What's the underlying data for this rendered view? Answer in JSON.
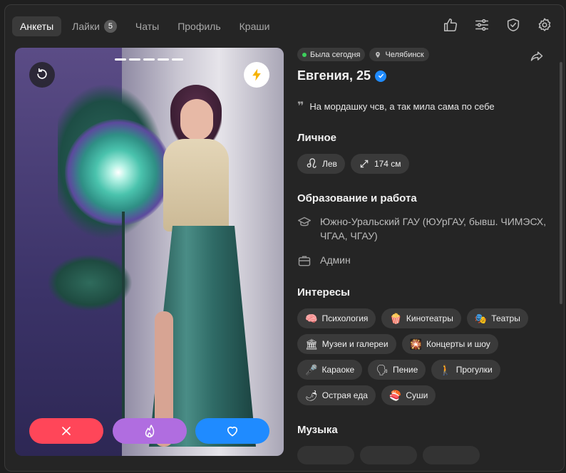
{
  "nav": {
    "tabs": [
      {
        "label": "Анкеты",
        "active": true
      },
      {
        "label": "Лайки",
        "badge": "5"
      },
      {
        "label": "Чаты"
      },
      {
        "label": "Профиль"
      },
      {
        "label": "Краши"
      }
    ],
    "icons": [
      "thumbs-up-icon",
      "filters-icon",
      "shield-check-icon",
      "gear-icon"
    ]
  },
  "card": {
    "photo_count": 5,
    "active_index": 0,
    "buttons": {
      "rewind": "rewind-icon",
      "boost": "lightning-icon",
      "dislike": "close-icon",
      "superlike": "flame-icon",
      "like": "heart-icon"
    }
  },
  "profile": {
    "status": "Была сегодня",
    "city": "Челябинск",
    "name": "Евгения, 25",
    "verified": true,
    "bio": "На мордашку чсв, а так мила сама по себе"
  },
  "personal": {
    "title": "Личное",
    "chips": [
      {
        "icon": "leo-icon",
        "label": "Лев"
      },
      {
        "icon": "height-icon",
        "label": "174 см"
      }
    ]
  },
  "work": {
    "title": "Образование и работа",
    "education": "Южно-Уральский ГАУ (ЮУрГАУ, бывш. ЧИМЭСХ, ЧГАА, ЧГАУ)",
    "job": "Админ"
  },
  "interests": {
    "title": "Интересы",
    "items": [
      {
        "emoji": "🧠",
        "label": "Психология"
      },
      {
        "emoji": "🍿",
        "label": "Кинотеатры"
      },
      {
        "emoji": "🎭",
        "label": "Театры"
      },
      {
        "emoji": "🏛",
        "label": "Музеи и галереи"
      },
      {
        "emoji": "🎇",
        "label": "Концерты и шоу"
      },
      {
        "emoji": "🎤",
        "label": "Караоке"
      },
      {
        "emoji": "🗣",
        "label": "Пение"
      },
      {
        "emoji": "🚶",
        "label": "Прогулки"
      },
      {
        "emoji": "🌶",
        "label": "Острая еда"
      },
      {
        "emoji": "🍣",
        "label": "Суши"
      }
    ]
  },
  "music": {
    "title": "Музыка"
  },
  "colors": {
    "dislike": "#ff4659",
    "superlike": "#b06de0",
    "like": "#1f8bff",
    "online": "#3ccf5b"
  }
}
